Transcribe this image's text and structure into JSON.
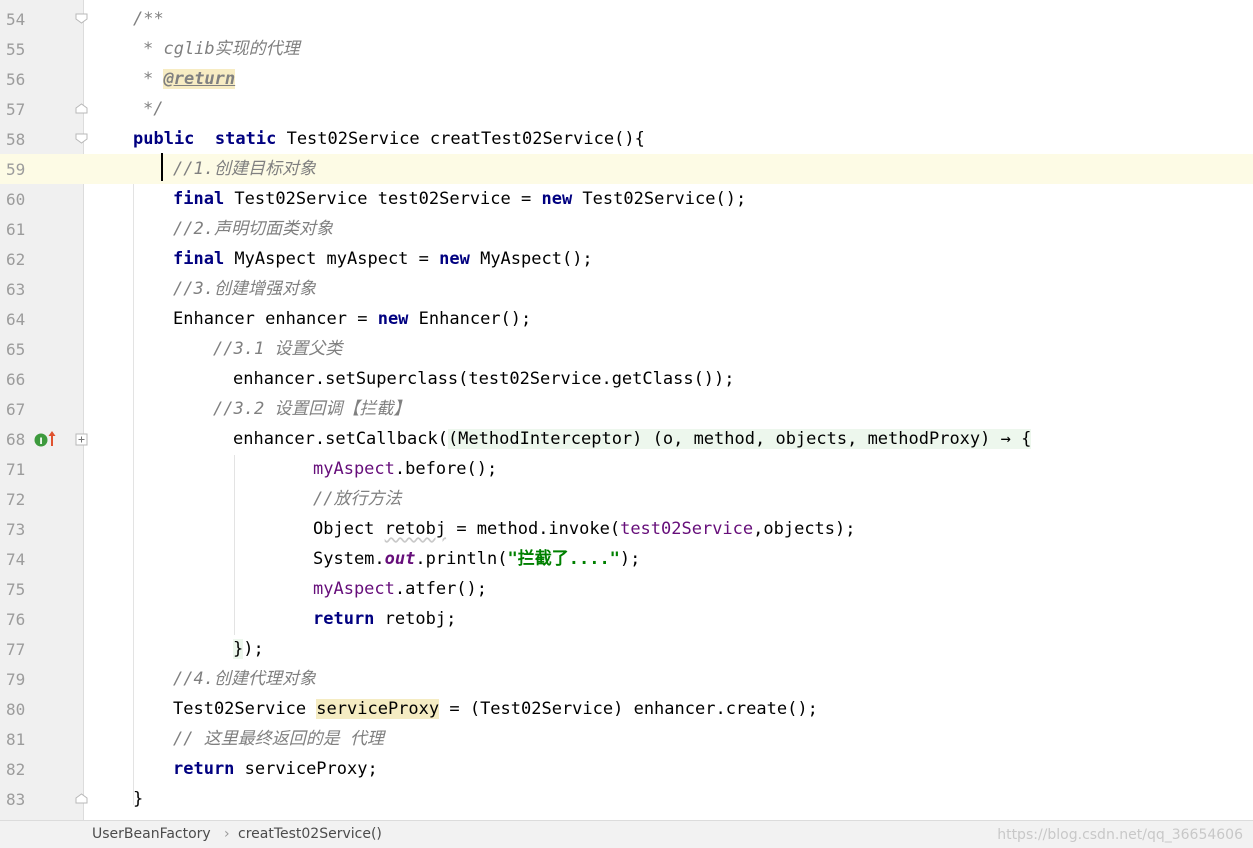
{
  "editor": {
    "lines": [
      {
        "num": "54"
      },
      {
        "num": "55"
      },
      {
        "num": "56"
      },
      {
        "num": "57"
      },
      {
        "num": "58"
      },
      {
        "num": "59"
      },
      {
        "num": "60"
      },
      {
        "num": "61"
      },
      {
        "num": "62"
      },
      {
        "num": "63"
      },
      {
        "num": "64"
      },
      {
        "num": "65"
      },
      {
        "num": "66"
      },
      {
        "num": "67"
      },
      {
        "num": "68"
      },
      {
        "num": "71"
      },
      {
        "num": "72"
      },
      {
        "num": "73"
      },
      {
        "num": "74"
      },
      {
        "num": "75"
      },
      {
        "num": "76"
      },
      {
        "num": "77"
      },
      {
        "num": "79"
      },
      {
        "num": "80"
      },
      {
        "num": "81"
      },
      {
        "num": "82"
      },
      {
        "num": "83"
      }
    ],
    "code": {
      "l54": "/**",
      "l55": "* cglib实现的代理",
      "l56_star": "* ",
      "l56_tag": "@return",
      "l57": "*/",
      "l58_kw1": "public",
      "l58_kw2": "static",
      "l58_rest": "Test02Service creatTest02Service(){",
      "l59": "//1.创建目标对象",
      "l60_kw": "final",
      "l60_a": " Test02Service test02Service = ",
      "l60_new": "new",
      "l60_b": " Test02Service();",
      "l61": "//2.声明切面类对象",
      "l62_kw": "final",
      "l62_a": " MyAspect myAspect = ",
      "l62_new": "new",
      "l62_b": " MyAspect();",
      "l63": "//3.创建增强对象",
      "l64_a": "Enhancer enhancer = ",
      "l64_new": "new",
      "l64_b": " Enhancer();",
      "l65": "//3.1 设置父类",
      "l66": "enhancer.setSuperclass(test02Service.getClass());",
      "l67": "//3.2 设置回调【拦截】",
      "l68_a": "enhancer.setCallback(",
      "l68_lambda": "(MethodInterceptor) (o, method, objects, methodProxy) → {",
      "l71_field": "myAspect",
      "l71_b": ".before();",
      "l72": "//放行方法",
      "l73_a": "Object ",
      "l73_var": "retobj",
      "l73_b": " = method.invoke(",
      "l73_field": "test02Service",
      "l73_c": ",objects);",
      "l74_a": "System.",
      "l74_field": "out",
      "l74_b": ".println(",
      "l74_str": "\"拦截了....\"",
      "l74_c": ");",
      "l75_field": "myAspect",
      "l75_b": ".atfer();",
      "l76_kw": "return",
      "l76_b": " retobj;",
      "l77_a": "}",
      "l77_b": ");",
      "l79": "//4.创建代理对象",
      "l80_a": "Test02Service ",
      "l80_var": "serviceProxy",
      "l80_b": " = (Test02Service) enhancer.create();",
      "l81": "// 这里最终返回的是 代理",
      "l82_kw": "return",
      "l82_b": " serviceProxy;",
      "l83": "}"
    },
    "gutter_marker": {
      "icon": "implementation-up-arrow-icon",
      "label": "I"
    }
  },
  "breadcrumb": {
    "items": [
      "UserBeanFactory",
      "creatTest02Service()"
    ],
    "separator": "›"
  },
  "watermark": "https://blog.csdn.net/qq_36654606",
  "colors": {
    "keyword": "#000080",
    "comment": "#808080",
    "field": "#660e7a",
    "string": "#008000",
    "current_line": "#fdfbe5",
    "lambda_bg": "#edf7ed"
  }
}
